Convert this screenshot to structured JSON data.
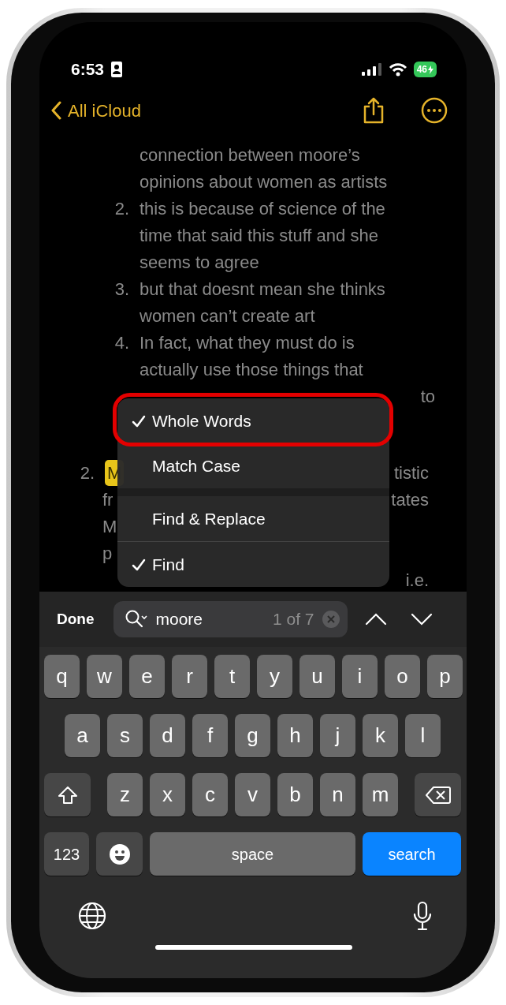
{
  "status_bar": {
    "time": "6:53",
    "battery": "46",
    "charging": true
  },
  "nav": {
    "back_label": "All iCloud"
  },
  "note": {
    "nested_lines": [
      {
        "text": "connection between moore’s"
      },
      {
        "text": "opinions about women as artists"
      },
      {
        "marker": "2.",
        "text": "this is because of science of the"
      },
      {
        "text": "time that said this stuff and she"
      },
      {
        "text": "seems to agree"
      },
      {
        "marker": "3.",
        "text": "but that doesnt mean she thinks"
      },
      {
        "text": "women can’t create art"
      },
      {
        "marker": "4.",
        "text": "In fact, what they must do is"
      },
      {
        "text": "actually use those things that"
      },
      {
        "right": "to"
      }
    ],
    "outer_lines": [
      {
        "marker": "2.",
        "left": "M",
        "match": true,
        "right": "tistic"
      },
      {
        "left": "fr",
        "match": false,
        "right": "tates"
      },
      {
        "left": "M",
        "match": false
      },
      {
        "left": "p",
        "match": false
      },
      {
        "right": "i.e."
      }
    ]
  },
  "menu": [
    {
      "label": "Whole Words",
      "checked": true,
      "highlighted": true,
      "gap_before": false,
      "line_before": false
    },
    {
      "label": "Match Case",
      "checked": false,
      "highlighted": false,
      "gap_before": false,
      "line_before": false
    },
    {
      "label": "Find & Replace",
      "checked": false,
      "highlighted": false,
      "gap_before": true,
      "line_before": false
    },
    {
      "label": "Find",
      "checked": true,
      "highlighted": false,
      "gap_before": false,
      "line_before": true
    }
  ],
  "find_bar": {
    "done": "Done",
    "query": "moore",
    "count": "1 of 7"
  },
  "keyboard": {
    "rows": [
      {
        "keys": [
          {
            "kind": "letter",
            "label": "q"
          },
          {
            "kind": "letter",
            "label": "w"
          },
          {
            "kind": "letter",
            "label": "e"
          },
          {
            "kind": "letter",
            "label": "r"
          },
          {
            "kind": "letter",
            "label": "t"
          },
          {
            "kind": "letter",
            "label": "y"
          },
          {
            "kind": "letter",
            "label": "u"
          },
          {
            "kind": "letter",
            "label": "i"
          },
          {
            "kind": "letter",
            "label": "o"
          },
          {
            "kind": "letter",
            "label": "p"
          }
        ]
      },
      {
        "keys": [
          {
            "kind": "letter",
            "label": "a"
          },
          {
            "kind": "letter",
            "label": "s"
          },
          {
            "kind": "letter",
            "label": "d"
          },
          {
            "kind": "letter",
            "label": "f"
          },
          {
            "kind": "letter",
            "label": "g"
          },
          {
            "kind": "letter",
            "label": "h"
          },
          {
            "kind": "letter",
            "label": "j"
          },
          {
            "kind": "letter",
            "label": "k"
          },
          {
            "kind": "letter",
            "label": "l"
          }
        ]
      },
      {
        "keys": [
          {
            "kind": "shift"
          },
          {
            "kind": "letter",
            "label": "z"
          },
          {
            "kind": "letter",
            "label": "x"
          },
          {
            "kind": "letter",
            "label": "c"
          },
          {
            "kind": "letter",
            "label": "v"
          },
          {
            "kind": "letter",
            "label": "b"
          },
          {
            "kind": "letter",
            "label": "n"
          },
          {
            "kind": "letter",
            "label": "m"
          },
          {
            "kind": "delete"
          }
        ]
      },
      {
        "keys": [
          {
            "kind": "mode",
            "label": "123"
          },
          {
            "kind": "emoji"
          },
          {
            "kind": "space",
            "label": "space"
          },
          {
            "kind": "action",
            "label": "search"
          }
        ]
      }
    ]
  }
}
